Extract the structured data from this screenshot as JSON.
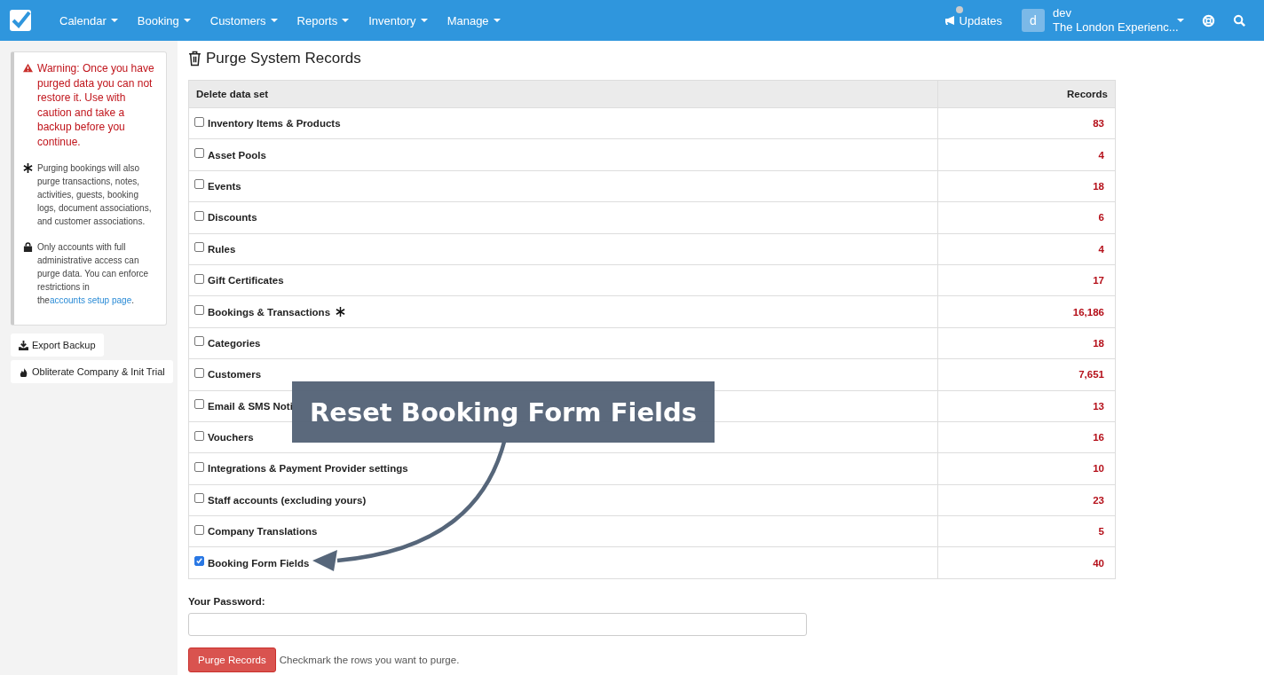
{
  "navbar": {
    "menus": [
      "Calendar",
      "Booking",
      "Customers",
      "Reports",
      "Inventory",
      "Manage"
    ],
    "updates": "Updates",
    "user": {
      "initial": "d",
      "name": "dev",
      "company": "The London Experienc..."
    }
  },
  "sidebar": {
    "warning": "Warning: Once you have purged data you can not restore it. Use with caution and take a backup before you continue.",
    "notes": [
      {
        "kind": "asterisk",
        "text": "Purging bookings will also purge transactions, notes, activities, guests, booking logs, document associations, and customer associations."
      },
      {
        "kind": "lock",
        "text": "Only accounts with full administrative access can purge data. You can enforce restrictions in the",
        "link": "accounts setup page",
        "after": "."
      }
    ],
    "buttons": [
      {
        "kind": "download",
        "label": "Export Backup"
      },
      {
        "kind": "flame",
        "label": "Obliterate Company & Init Trial"
      }
    ]
  },
  "page_title": "Purge System Records",
  "table": {
    "columns": [
      "Delete data set",
      "Records"
    ],
    "rows": [
      {
        "label": "Inventory Items & Products",
        "checked": false,
        "starred": false,
        "count": "83"
      },
      {
        "label": "Asset Pools",
        "checked": false,
        "starred": false,
        "count": "4"
      },
      {
        "label": "Events",
        "checked": false,
        "starred": false,
        "count": "18"
      },
      {
        "label": "Discounts",
        "checked": false,
        "starred": false,
        "count": "6"
      },
      {
        "label": "Rules",
        "checked": false,
        "starred": false,
        "count": "4"
      },
      {
        "label": "Gift Certificates",
        "checked": false,
        "starred": false,
        "count": "17"
      },
      {
        "label": "Bookings & Transactions",
        "checked": false,
        "starred": true,
        "count": "16,186"
      },
      {
        "label": "Categories",
        "checked": false,
        "starred": false,
        "count": "18"
      },
      {
        "label": "Customers",
        "checked": false,
        "starred": false,
        "count": "7,651"
      },
      {
        "label": "Email & SMS Noti",
        "checked": false,
        "starred": false,
        "count": "13"
      },
      {
        "label": "Vouchers",
        "checked": false,
        "starred": false,
        "count": "16"
      },
      {
        "label": "Integrations & Payment Provider settings",
        "checked": false,
        "starred": false,
        "count": "10"
      },
      {
        "label": "Staff accounts (excluding yours)",
        "checked": false,
        "starred": false,
        "count": "23"
      },
      {
        "label": "Company Translations",
        "checked": false,
        "starred": false,
        "count": "5"
      },
      {
        "label": "Booking Form Fields",
        "checked": true,
        "starred": false,
        "count": "40"
      }
    ]
  },
  "password": {
    "label": "Your Password:"
  },
  "submit": {
    "label": "Purge Records",
    "hint": "Checkmark the rows you want to purge."
  },
  "callout": {
    "text": "Reset Booking Form Fields"
  }
}
